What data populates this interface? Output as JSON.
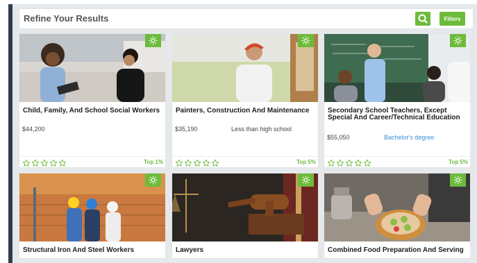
{
  "refine": {
    "title": "Refine Your Results",
    "search_icon": "search-icon",
    "filters_label": "Filters"
  },
  "colors": {
    "accent": "#6dbb3b",
    "link": "#3a8fd8",
    "frame_border": "#2f3e4d",
    "background": "#e6e9ec"
  },
  "cards": [
    {
      "title": "Child, Family, And School Social Workers",
      "salary": "$44,200",
      "education": "",
      "rating": 0,
      "rank": "Top 1%",
      "badge_icon": "sun-icon"
    },
    {
      "title": "Painters, Construction And Maintenance",
      "salary": "$35,190",
      "education": "Less than high school",
      "rating": 0,
      "rank": "Top 5%",
      "badge_icon": "sun-icon"
    },
    {
      "title": "Secondary School Teachers, Except Special And Career/Technical Education",
      "salary": "$55,050",
      "education": "Bachelor's degree",
      "rating": 0,
      "rank": "Top 5%",
      "badge_icon": "sun-icon"
    },
    {
      "title": "Structural Iron And Steel Workers",
      "badge_icon": "sun-icon"
    },
    {
      "title": "Lawyers",
      "badge_icon": "sun-icon"
    },
    {
      "title": "Combined Food Preparation And Serving",
      "badge_icon": "sun-icon"
    }
  ]
}
